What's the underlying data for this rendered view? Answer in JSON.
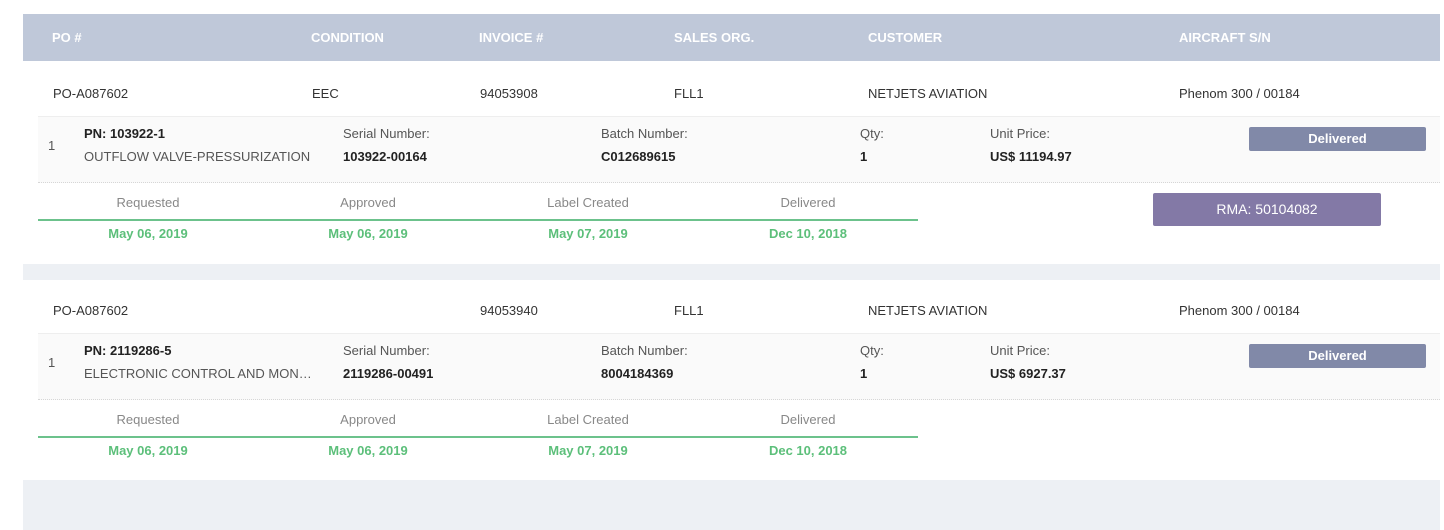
{
  "header": {
    "po": "PO #",
    "condition": "CONDITION",
    "invoice": "INVOICE #",
    "sales_org": "SALES ORG.",
    "customer": "CUSTOMER",
    "aircraft": "AIRCRAFT S/N"
  },
  "orders": [
    {
      "po": "PO-A087602",
      "condition": "EEC",
      "invoice": "94053908",
      "sales_org": "FLL1",
      "customer": "NETJETS AVIATION",
      "aircraft": "Phenom 300 / 00184",
      "item": {
        "index": "1",
        "pn": "PN: 103922-1",
        "description": "OUTFLOW VALVE-PRESSURIZATION",
        "serial_label": "Serial Number:",
        "serial": "103922-00164",
        "batch_label": "Batch Number:",
        "batch": "C012689615",
        "qty_label": "Qty:",
        "qty": "1",
        "price_label": "Unit Price:",
        "price": "US$ 11194.97",
        "status": "Delivered"
      },
      "tracking": {
        "steps": [
          "Requested",
          "Approved",
          "Label Created",
          "Delivered"
        ],
        "dates": [
          "May 06, 2019",
          "May 06, 2019",
          "May 07, 2019",
          "Dec 10, 2018"
        ]
      },
      "rma": "RMA: 50104082"
    },
    {
      "po": "PO-A087602",
      "condition": "",
      "invoice": "94053940",
      "sales_org": "FLL1",
      "customer": "NETJETS AVIATION",
      "aircraft": "Phenom 300 / 00184",
      "item": {
        "index": "1",
        "pn": "PN: 2119286-5",
        "description": "ELECTRONIC CONTROL AND MONITORING",
        "serial_label": "Serial Number:",
        "serial": "2119286-00491",
        "batch_label": "Batch Number:",
        "batch": "8004184369",
        "qty_label": "Qty:",
        "qty": "1",
        "price_label": "Unit Price:",
        "price": "US$ 6927.37",
        "status": "Delivered"
      },
      "tracking": {
        "steps": [
          "Requested",
          "Approved",
          "Label Created",
          "Delivered"
        ],
        "dates": [
          "May 06, 2019",
          "May 06, 2019",
          "May 07, 2019",
          "Dec 10, 2018"
        ]
      }
    }
  ],
  "colors": {
    "header_bg": "#bfc8d9",
    "status_button": "#8189a8",
    "rma_button": "#8379a6",
    "tracking_green": "#5cbf7a"
  }
}
